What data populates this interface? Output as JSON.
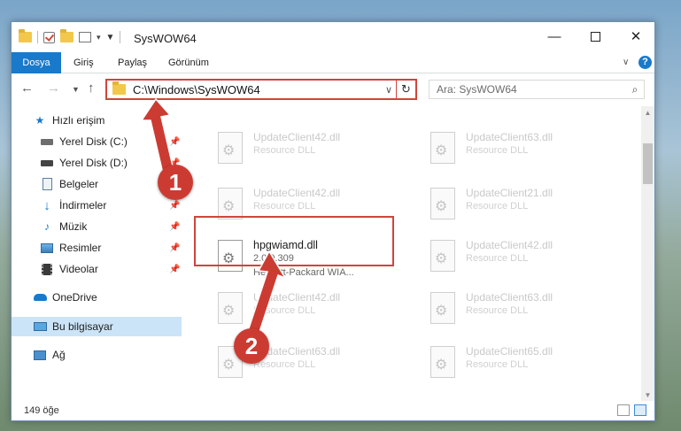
{
  "window": {
    "title": "SysWOW64"
  },
  "ribbon": {
    "tabs": [
      "Dosya",
      "Giriş",
      "Paylaş",
      "Görünüm"
    ],
    "help": "?"
  },
  "address": {
    "path": "C:\\Windows\\SysWOW64"
  },
  "search": {
    "placeholder": "Ara: SysWOW64"
  },
  "sidebar": {
    "items": [
      {
        "label": "Hızlı erişim",
        "icon": "star-icon"
      },
      {
        "label": "Yerel Disk (C:)",
        "icon": "drive-icon",
        "pinned": true
      },
      {
        "label": "Yerel Disk (D:)",
        "icon": "drive-icon",
        "pinned": true
      },
      {
        "label": "Belgeler",
        "icon": "document-icon",
        "pinned": true
      },
      {
        "label": "İndirmeler",
        "icon": "download-icon",
        "pinned": true
      },
      {
        "label": "Müzik",
        "icon": "music-icon",
        "pinned": true
      },
      {
        "label": "Resimler",
        "icon": "pictures-icon",
        "pinned": true
      },
      {
        "label": "Videolar",
        "icon": "videos-icon",
        "pinned": true
      },
      {
        "label": "OneDrive",
        "icon": "cloud-icon"
      },
      {
        "label": "Bu bilgisayar",
        "icon": "computer-icon",
        "selected": true
      },
      {
        "label": "Ağ",
        "icon": "network-icon"
      }
    ]
  },
  "files": [
    {
      "name": "UpdateClient42.dll",
      "type": "Resource DLL"
    },
    {
      "name": "UpdateClient63.dll",
      "type": "Resource DLL"
    },
    {
      "name": "UpdateClient42.dll",
      "type": "Resource DLL"
    },
    {
      "name": "UpdateClient21.dll",
      "type": "Resource DLL"
    },
    {
      "name": "hpgwiamd.dll",
      "version": "2.0.0.309",
      "company": "Hewlett-Packard WIA...",
      "focused": true
    },
    {
      "name": "UpdateClient42.dll",
      "type": "Resource DLL"
    },
    {
      "name": "UpdateClient42.dll",
      "type": "Resource DLL"
    },
    {
      "name": "UpdateClient63.dll",
      "type": "Resource DLL"
    },
    {
      "name": "UpdateClient63.dll",
      "type": "Resource DLL"
    },
    {
      "name": "UpdateClient65.dll",
      "type": "Resource DLL"
    }
  ],
  "status": {
    "count": "149 öğe"
  },
  "callouts": {
    "one": "1",
    "two": "2"
  },
  "colors": {
    "accent": "#1979ca",
    "highlight": "#d0453b",
    "callout": "#cc3b32"
  }
}
